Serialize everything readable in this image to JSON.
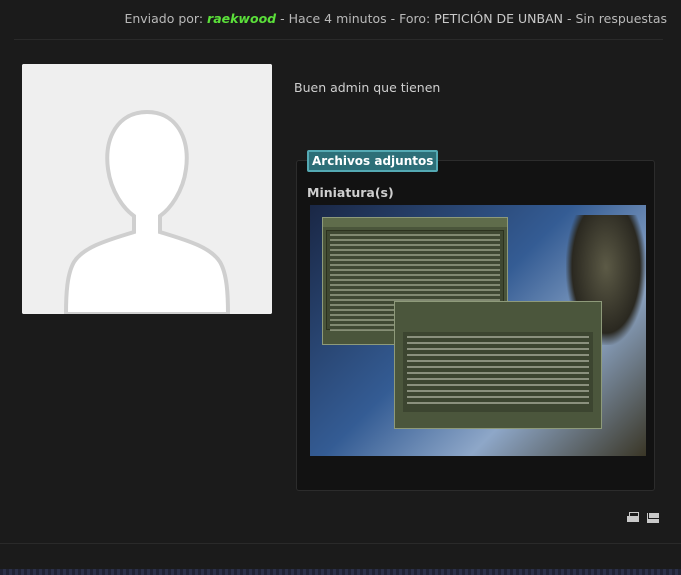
{
  "post_meta": {
    "prefix": "Enviado por:",
    "author": "raekwood",
    "time_sep": " - ",
    "time": "Hace 4 minutos",
    "forum_prefix": " - Foro: ",
    "forum": "PETICIÓN DE UNBAN",
    "replies_sep": " - ",
    "replies": "Sin respuestas"
  },
  "post": {
    "body": "Buen admin que tienen"
  },
  "attachments": {
    "tab_label": "Archivos adjuntos",
    "thumbnail_title": "Miniatura(s)",
    "thumbnail_icon": "counter-strike-screenshot"
  },
  "actions": {
    "print_icon": "print-icon",
    "email_icon": "mail-icon"
  },
  "colors": {
    "background": "#1b1b1b",
    "author": "#5be03a",
    "tab": "#2d6f78"
  }
}
